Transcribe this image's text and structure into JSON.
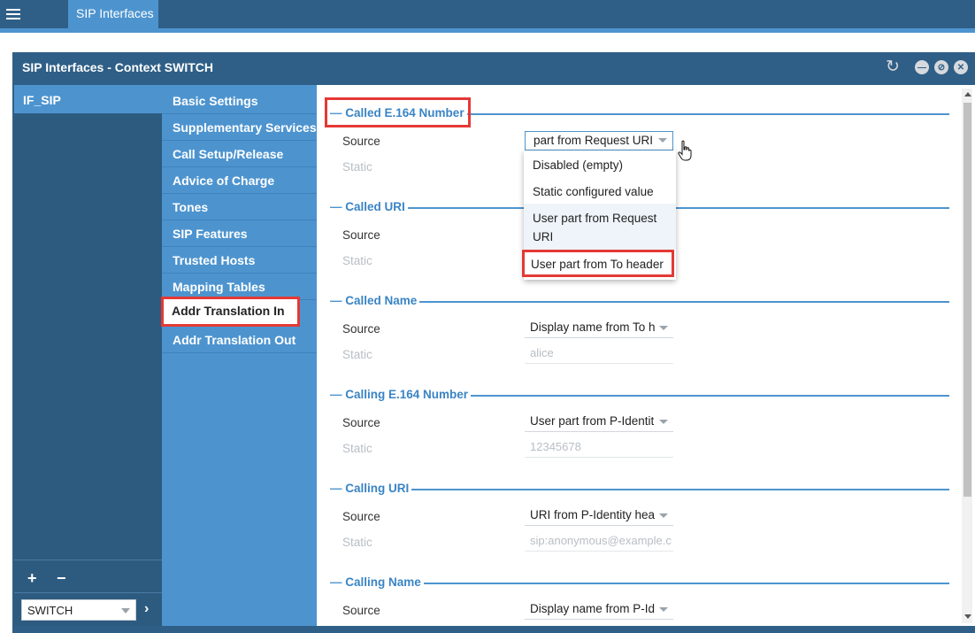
{
  "topbar": {
    "tab_label": "SIP Interfaces"
  },
  "window": {
    "title": "SIP Interfaces - Context SWITCH"
  },
  "left_panel": {
    "items": [
      {
        "label": "IF_SIP"
      }
    ],
    "add_label": "+",
    "remove_label": "−",
    "context_select": {
      "value": "SWITCH"
    }
  },
  "nav": {
    "items": [
      {
        "label": "Basic Settings"
      },
      {
        "label": "Supplementary Services"
      },
      {
        "label": "Call Setup/Release"
      },
      {
        "label": "Advice of Charge"
      },
      {
        "label": "Tones"
      },
      {
        "label": "SIP Features"
      },
      {
        "label": "Trusted Hosts"
      },
      {
        "label": "Mapping Tables"
      },
      {
        "label": "Addr Translation In"
      },
      {
        "label": "Addr Translation Out"
      }
    ],
    "active": "Addr Translation In"
  },
  "sections": [
    {
      "title": "Called E.164 Number",
      "source_label": "Source",
      "source_value": "part from Request URI",
      "static_label": "Static",
      "static_value": ""
    },
    {
      "title": "Called URI",
      "source_label": "Source",
      "source_value": "",
      "static_label": "Static",
      "static_value": ""
    },
    {
      "title": "Called Name",
      "source_label": "Source",
      "source_value": "Display name from To h",
      "static_label": "Static",
      "static_value": "alice"
    },
    {
      "title": "Calling E.164 Number",
      "source_label": "Source",
      "source_value": "User part from P-Identit",
      "static_label": "Static",
      "static_value": "12345678"
    },
    {
      "title": "Calling URI",
      "source_label": "Source",
      "source_value": "URI from P-Identity hea",
      "static_label": "Static",
      "static_value": "sip:anonymous@example.c"
    },
    {
      "title": "Calling Name",
      "source_label": "Source",
      "source_value": "Display name from P-Id"
    }
  ],
  "dropdown": {
    "options": [
      {
        "label": "Disabled (empty)"
      },
      {
        "label": "Static configured value"
      },
      {
        "label": "User part from Request URI"
      },
      {
        "label": "User part from To header"
      }
    ]
  },
  "colors": {
    "topbar": "#2f5f87",
    "accent": "#4d94cf",
    "highlight_box": "#e53935",
    "section_title": "#3a84c4"
  }
}
